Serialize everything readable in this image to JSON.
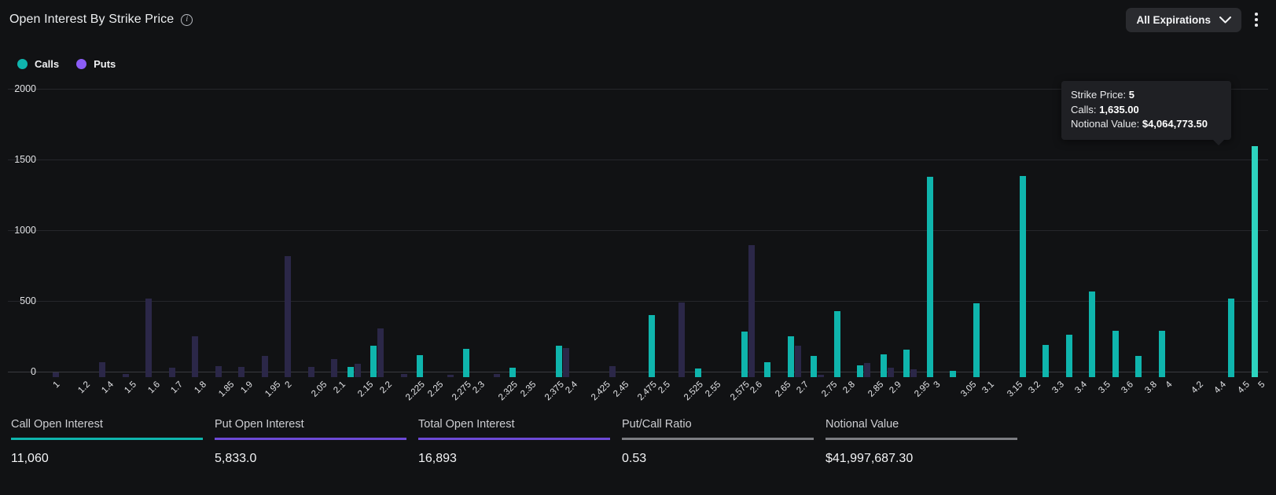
{
  "header": {
    "title": "Open Interest By Strike Price",
    "info_icon": "info-icon",
    "expiration_filter": "All Expirations",
    "chevron_icon": "chevron-down-icon",
    "menu_icon": "kebab-menu-icon"
  },
  "legend": [
    {
      "label": "Calls",
      "color": "#0fb5ad"
    },
    {
      "label": "Puts",
      "color": "#8b5cf6"
    }
  ],
  "tooltip": {
    "strike_label": "Strike Price:",
    "strike_value": "5",
    "calls_label": "Calls:",
    "calls_value": "1,635.00",
    "notional_label": "Notional Value:",
    "notional_value": "$4,064,773.50"
  },
  "stats": [
    {
      "label": "Call Open Interest",
      "value": "11,060",
      "accent": "#0fb5ad"
    },
    {
      "label": "Put Open Interest",
      "value": "5,833.0",
      "accent": "#6d4ad6"
    },
    {
      "label": "Total Open Interest",
      "value": "16,893",
      "accent": "#6d4ad6"
    },
    {
      "label": "Put/Call Ratio",
      "value": "0.53",
      "accent": "#7c7d82"
    },
    {
      "label": "Notional Value",
      "value": "$41,997,687.30",
      "accent": "#7c7d82"
    }
  ],
  "chart_data": {
    "type": "bar",
    "title": "Open Interest By Strike Price",
    "xlabel": "Strike Price",
    "ylabel": "Open Interest",
    "ylim": [
      0,
      2000
    ],
    "yticks": [
      0,
      500,
      1000,
      1500,
      2000
    ],
    "grid": true,
    "legend_position": "top-left",
    "colors": {
      "calls": "#0fb5ad",
      "puts": "#8b5cf6",
      "puts_dimmed": "#2b2748",
      "calls_highlight": "#2dd4bf"
    },
    "highlighted_category": "5",
    "categories": [
      "1",
      "1.2",
      "1.4",
      "1.5",
      "1.6",
      "1.7",
      "1.8",
      "1.85",
      "1.9",
      "1.95",
      "2",
      "2.05",
      "2.1",
      "2.15",
      "2.2",
      "2.225",
      "2.25",
      "2.275",
      "2.3",
      "2.325",
      "2.35",
      "2.375",
      "2.4",
      "2.425",
      "2.45",
      "2.475",
      "2.5",
      "2.525",
      "2.55",
      "2.575",
      "2.6",
      "2.65",
      "2.7",
      "2.75",
      "2.8",
      "2.85",
      "2.9",
      "2.95",
      "3",
      "3.05",
      "3.1",
      "3.15",
      "3.2",
      "3.3",
      "3.4",
      "3.5",
      "3.6",
      "3.8",
      "4",
      "4.2",
      "4.4",
      "4.5",
      "5"
    ],
    "series": [
      {
        "name": "Calls",
        "color": "#0fb5ad",
        "values": [
          0,
          0,
          0,
          0,
          0,
          0,
          0,
          0,
          0,
          0,
          0,
          0,
          0,
          70,
          225,
          0,
          155,
          0,
          200,
          0,
          65,
          0,
          220,
          0,
          0,
          0,
          440,
          0,
          60,
          0,
          325,
          105,
          290,
          150,
          465,
          85,
          160,
          195,
          1415,
          45,
          520,
          0,
          1420,
          230,
          300,
          605,
          330,
          150,
          330,
          0,
          0,
          555,
          1635
        ]
      },
      {
        "name": "Puts",
        "color": "#8b5cf6",
        "values": [
          35,
          0,
          105,
          20,
          555,
          65,
          290,
          80,
          75,
          150,
          855,
          75,
          130,
          95,
          345,
          25,
          0,
          15,
          0,
          25,
          0,
          0,
          205,
          0,
          80,
          0,
          0,
          530,
          0,
          0,
          935,
          0,
          220,
          15,
          0,
          100,
          65,
          55,
          0,
          0,
          0,
          0,
          0,
          0,
          0,
          0,
          0,
          0,
          0,
          0,
          0,
          0,
          0
        ]
      }
    ]
  }
}
